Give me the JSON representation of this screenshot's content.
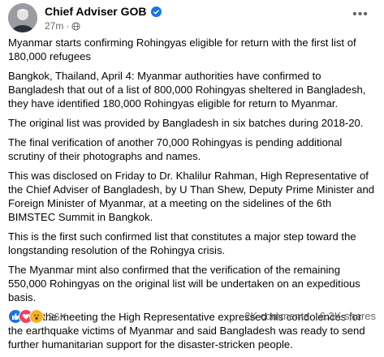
{
  "post": {
    "author": "Chief Adviser GOB",
    "time": "27m",
    "separator": "·",
    "more_label": "•••",
    "paragraphs": [
      "Myanmar starts confirming Rohingyas eligible for return with the first list of 180,000 refugees",
      "Bangkok, Thailand, April 4: Myanmar authorities have confirmed to Bangladesh that out of a list of 800,000 Rohingyas sheltered in Bangladesh, they have identified 180,000 Rohingyas eligible for return to Myanmar.",
      "The original list was provided by Bangladesh in six batches during 2018-20.",
      "The final verification of another 70,000 Rohingyas is pending additional scrutiny of their photographs and names.",
      "This was disclosed on Friday to Dr. Khalilur Rahman, High Representative of the Chief Adviser of Bangladesh, by U Than Shew, Deputy Prime Minister and Foreign Minister of Myanmar, at a meeting on the sidelines of the 6th BIMSTEC Summit in Bangkok.",
      "This is the first such confirmed list that constitutes a major step toward the longstanding resolution of the Rohingya crisis.",
      "The Myanmar mint also confirmed that the verification of the remaining 550,000 Rohingyas on the original list will be undertaken on an expeditious basis.",
      "During the meeting the High Representative expressed his condolences for the earthquake victims of Myanmar and said Bangladesh was ready to send further humanitarian support for the disaster-stricken people."
    ]
  },
  "footer": {
    "reactions_count": "26K",
    "comments": "2K comments",
    "shares": "6.3K shares",
    "reaction_icons": [
      "like-icon",
      "love-icon",
      "wow-icon"
    ]
  },
  "colors": {
    "accent": "#1b74e4",
    "secondary_text": "#65676b"
  }
}
